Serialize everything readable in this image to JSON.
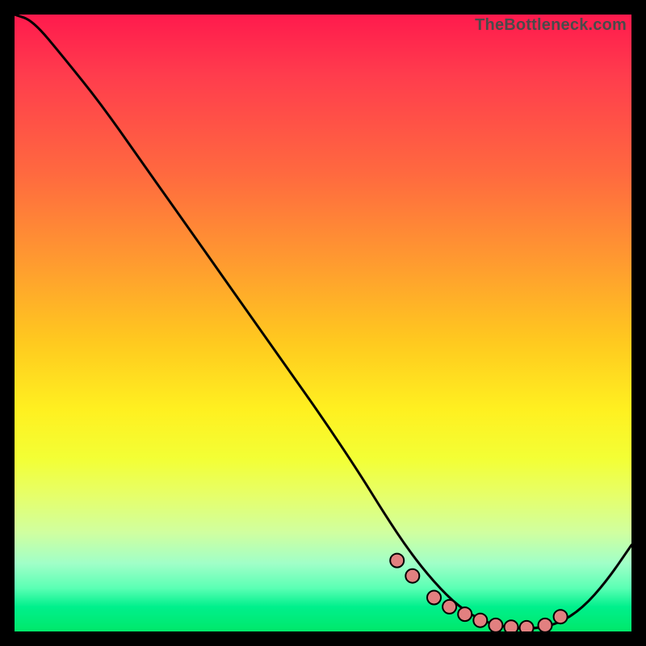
{
  "watermark": "TheBottleneck.com",
  "colors": {
    "background": "#000000",
    "curve": "#000000",
    "marker_fill": "#e28080",
    "marker_stroke": "#000000",
    "gradient_stops": [
      "#ff1a4d",
      "#ff6a3f",
      "#ffc91f",
      "#fff020",
      "#e6ff6a",
      "#5affb4",
      "#00e86a"
    ]
  },
  "chart_data": {
    "type": "line",
    "title": "",
    "xlabel": "",
    "ylabel": "",
    "xlim": [
      0,
      100
    ],
    "ylim": [
      0,
      100
    ],
    "grid": false,
    "legend": false,
    "series": [
      {
        "name": "bottleneck-curve",
        "x": [
          0,
          3,
          8,
          14,
          20,
          26,
          32,
          38,
          44,
          50,
          56,
          60,
          64,
          68,
          72,
          76,
          80,
          84,
          88,
          92,
          96,
          100
        ],
        "y": [
          101,
          99,
          93,
          85.5,
          77,
          68.5,
          60,
          51.5,
          43,
          34.5,
          25.5,
          19,
          13,
          8,
          4,
          1.6,
          0.6,
          0.4,
          1.2,
          3.7,
          8.2,
          14
        ]
      }
    ],
    "markers": {
      "name": "highlight-points",
      "x": [
        62,
        64.5,
        68,
        70.5,
        73,
        75.5,
        78,
        80.5,
        83,
        86,
        88.5
      ],
      "y": [
        11.5,
        9,
        5.5,
        4,
        2.8,
        1.8,
        1.0,
        0.7,
        0.6,
        1.0,
        2.4
      ]
    }
  }
}
